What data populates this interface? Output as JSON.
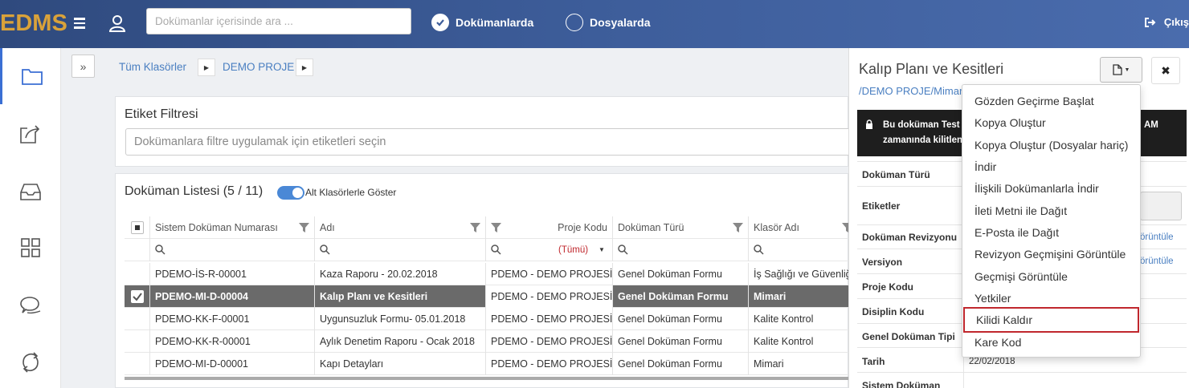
{
  "app": {
    "logo": "EDMS"
  },
  "topbar": {
    "search_placeholder": "Dokümanlar içerisinde ara ...",
    "radio_options": [
      {
        "label": "Dokümanlarda",
        "checked": true
      },
      {
        "label": "Dosyalarda",
        "checked": false
      }
    ],
    "logout_label": "Çıkış"
  },
  "leftnav": {
    "items": [
      {
        "icon": "folder-icon",
        "active": true
      },
      {
        "icon": "share-icon",
        "active": false
      },
      {
        "icon": "inbox-icon",
        "active": false
      },
      {
        "icon": "grid-icon",
        "active": false
      },
      {
        "icon": "chat-icon",
        "active": false
      },
      {
        "icon": "sync-icon",
        "active": false
      }
    ]
  },
  "breadcrumb": {
    "items": [
      "Tüm Klasörler",
      "DEMO PROJE"
    ]
  },
  "tag_filter": {
    "title": "Etiket Filtresi",
    "placeholder": "Dokümanlara filtre uygulamak için etiketleri seçin"
  },
  "doc_list": {
    "title": "Doküman Listesi (5 / 11)",
    "toggle_label": "Alt Klasörlerle Göster",
    "toggle_on": true,
    "columns": [
      "Sistem Doküman Numarası",
      "Adı",
      "Proje Kodu",
      "Doküman Türü",
      "Klasör Adı"
    ],
    "project_filter_value": "(Tümü)",
    "rows": [
      {
        "number": "PDEMO-İS-R-00001",
        "name": "Kaza Raporu - 20.02.2018",
        "project": "PDEMO - DEMO PROJESİ",
        "type": "Genel Doküman Formu",
        "folder": "İş Sağlığı ve Güvenliği",
        "selected": false
      },
      {
        "number": "PDEMO-MI-D-00004",
        "name": "Kalıp Planı ve Kesitleri",
        "project": "PDEMO - DEMO PROJESİ",
        "type": "Genel Doküman Formu",
        "folder": "Mimari",
        "selected": true
      },
      {
        "number": "PDEMO-KK-F-00001",
        "name": "Uygunsuzluk Formu- 05.01.2018",
        "project": "PDEMO - DEMO PROJESİ",
        "type": "Genel Doküman Formu",
        "folder": "Kalite Kontrol",
        "selected": false
      },
      {
        "number": "PDEMO-KK-R-00001",
        "name": "Aylık Denetim Raporu - Ocak 2018",
        "project": "PDEMO - DEMO PROJESİ",
        "type": "Genel Doküman Formu",
        "folder": "Kalite Kontrol",
        "selected": false
      },
      {
        "number": "PDEMO-MI-D-00001",
        "name": "Kapı Detayları",
        "project": "PDEMO - DEMO PROJESİ",
        "type": "Genel Doküman Formu",
        "folder": "Mimari",
        "selected": false
      }
    ]
  },
  "detail": {
    "title": "Kalıp Planı ve Kesitleri",
    "path": "/DEMO PROJE/Mimari",
    "lock_line1_start": "Bu doküman Test",
    "lock_line1_end": "AM",
    "lock_line2": "zamanında kilitlendi.",
    "properties": [
      {
        "label": "Doküman Türü",
        "value": ""
      },
      {
        "label": "Etiketler",
        "value": ""
      },
      {
        "label": "Doküman Revizyonu",
        "value": "örüntüle"
      },
      {
        "label": "Versiyon",
        "value": "örüntüle"
      },
      {
        "label": "Proje Kodu",
        "value": ""
      },
      {
        "label": "Disiplin Kodu",
        "value": ""
      },
      {
        "label": "Genel Doküman Tipi",
        "value": ""
      },
      {
        "label": "Tarih",
        "value": "22/02/2018"
      },
      {
        "label": "Sistem Doküman",
        "value": ""
      }
    ]
  },
  "menu": {
    "items": [
      "Gözden Geçirme Başlat",
      "Kopya Oluştur",
      "Kopya Oluştur (Dosyalar hariç)",
      "İndir",
      "İlişkili Dokümanlarla İndir",
      "İleti Metni ile Dağıt",
      "E-Posta ile Dağıt",
      "Revizyon Geçmişini Görüntüle",
      "Geçmişi Görüntüle",
      "Yetkiler",
      "Kilidi Kaldır",
      "Kare Kod"
    ],
    "highlighted_index": 10
  },
  "colors": {
    "accent": "#4a7fc1",
    "logo": "#d9a23a",
    "highlight_border": "#c0272d",
    "selected_row": "#6a6a6a"
  }
}
